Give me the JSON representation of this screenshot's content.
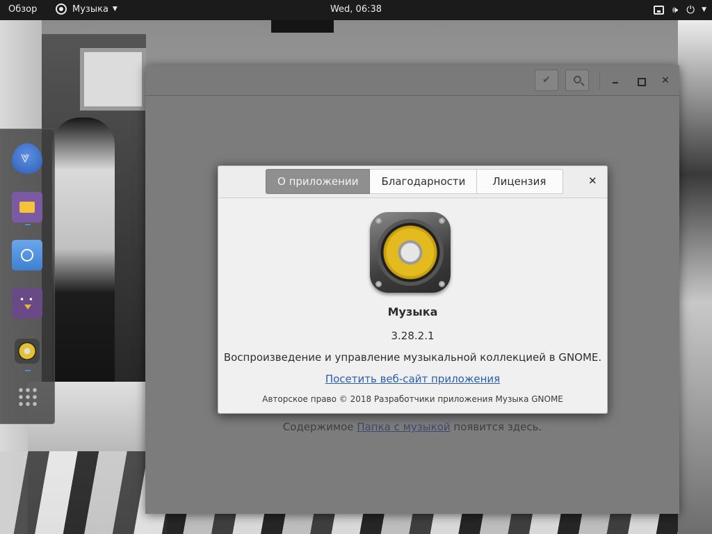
{
  "topbar": {
    "activities": "Обзор",
    "app_menu": "Музыка",
    "clock": "Wed, 06:38"
  },
  "dock": {
    "items": [
      "bird-app",
      "files",
      "browser",
      "chat-app",
      "music",
      "app-grid"
    ],
    "running_indicator_color": "#4a90d9"
  },
  "window": {
    "header_buttons": [
      "checkmark-icon",
      "search-icon"
    ],
    "empty_state": {
      "prefix": "Содержимое ",
      "link": "Папка с музыкой",
      "suffix": " появится здесь."
    }
  },
  "about_dialog": {
    "tabs": [
      {
        "label": "О приложении",
        "active": true
      },
      {
        "label": "Благодарности",
        "active": false
      },
      {
        "label": "Лицензия",
        "active": false
      }
    ],
    "app_name": "Музыка",
    "version": "3.28.2.1",
    "description": "Воспроизведение и управление музыкальной коллекцией в GNOME.",
    "website_link": "Посетить веб-сайт приложения",
    "copyright": "Авторское право © 2018 Разработчики приложения Музыка GNOME",
    "accent_color": "#e3bb1f",
    "link_color": "#2a5db0"
  }
}
